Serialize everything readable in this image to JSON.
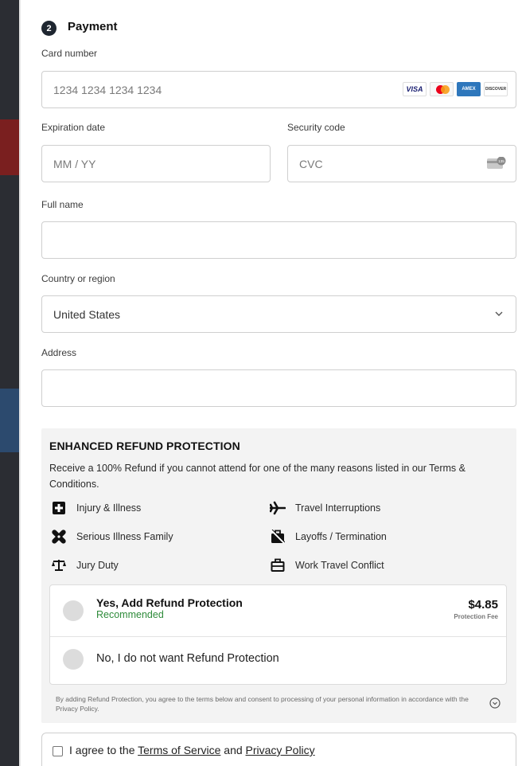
{
  "payment": {
    "step": "2",
    "title": "Payment",
    "card_number": {
      "label": "Card number",
      "placeholder": "1234 1234 1234 1234"
    },
    "card_logos": [
      "VISA",
      "mastercard",
      "AMEX",
      "DISCOVER"
    ],
    "expiration": {
      "label": "Expiration date",
      "placeholder": "MM / YY"
    },
    "security": {
      "label": "Security code",
      "placeholder": "CVC",
      "icon_text": "135"
    },
    "full_name": {
      "label": "Full name",
      "placeholder": ""
    },
    "country": {
      "label": "Country or region",
      "value": "United States"
    },
    "address": {
      "label": "Address",
      "placeholder": ""
    }
  },
  "refund": {
    "title": "ENHANCED REFUND PROTECTION",
    "description": "Receive a 100% Refund if you cannot attend for one of the many reasons listed in our Terms & Conditions.",
    "features": [
      {
        "label": "Injury & Illness",
        "icon": "first-aid-icon"
      },
      {
        "label": "Travel Interruptions",
        "icon": "airplane-icon"
      },
      {
        "label": "Serious Illness Family",
        "icon": "bandage-icon"
      },
      {
        "label": "Layoffs / Termination",
        "icon": "no-briefcase-icon"
      },
      {
        "label": "Jury Duty",
        "icon": "scales-icon"
      },
      {
        "label": "Work Travel Conflict",
        "icon": "briefcase-icon"
      }
    ],
    "yes": {
      "label": "Yes, Add Refund Protection",
      "badge": "Recommended",
      "price": "$4.85",
      "price_sub": "Protection Fee"
    },
    "no": {
      "label": "No, I do not want Refund Protection"
    },
    "fine_print": "By adding Refund Protection, you agree to the terms below and consent to processing of your personal information in accordance with the Privacy Policy."
  },
  "agree": {
    "prefix": "I agree to the ",
    "terms": "Terms of Service",
    "and": " and ",
    "privacy": "Privacy Policy"
  },
  "colors": {
    "accent_green": "#2e8b3a",
    "badge_dark": "#1e2630",
    "panel_bg": "#f3f3f3"
  }
}
